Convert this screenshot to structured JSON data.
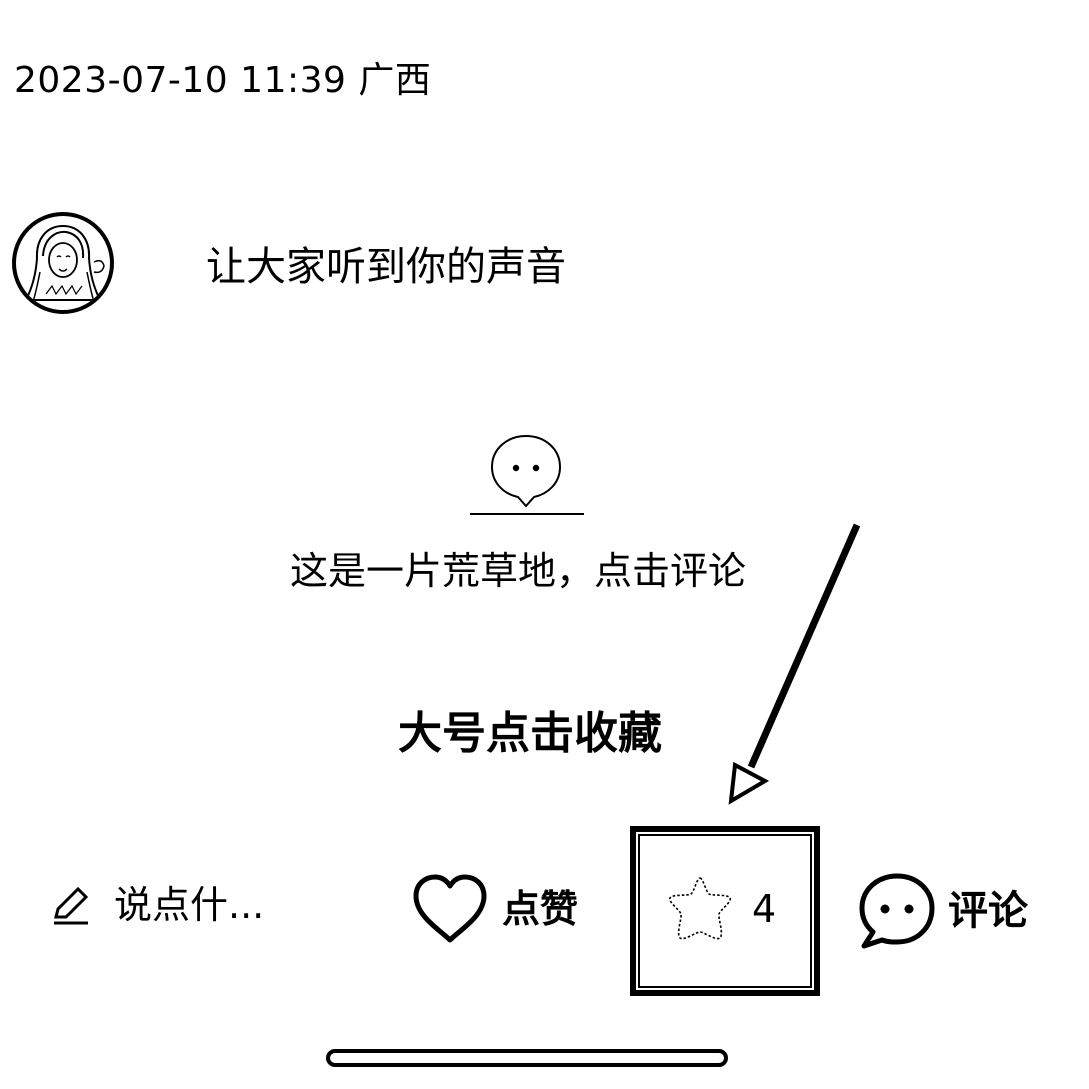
{
  "post": {
    "timestamp": "2023-07-10 11:39 广西"
  },
  "prompt": {
    "text": "让大家听到你的声音"
  },
  "empty_state": {
    "icon": "chat-bubble-icon",
    "text": "这是一片荒草地，点击评论"
  },
  "annotation": {
    "text": "大号点击收藏",
    "arrow_icon": "arrow-icon"
  },
  "action_bar": {
    "compose": {
      "icon": "pencil-icon",
      "placeholder": "说点什..."
    },
    "like": {
      "icon": "heart-icon",
      "label": "点赞"
    },
    "collect": {
      "icon": "star-icon",
      "count": "4"
    },
    "comment": {
      "icon": "comment-bubble-icon",
      "label": "评论"
    }
  }
}
